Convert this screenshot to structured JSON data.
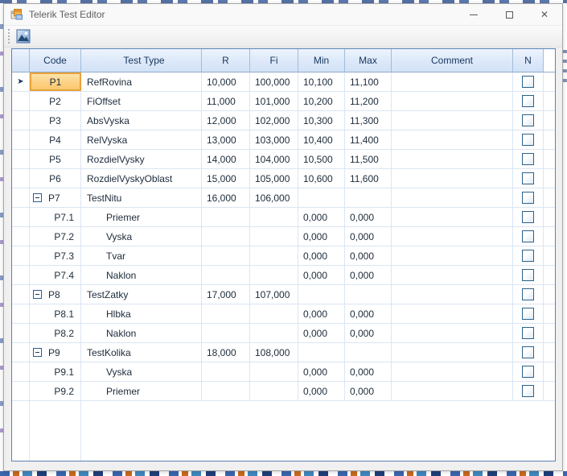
{
  "window": {
    "title": "Telerik Test Editor",
    "app_icon": "winforms-form-icon",
    "controls": [
      {
        "name": "minimize",
        "glyph": "—"
      },
      {
        "name": "maximize",
        "glyph": "□"
      },
      {
        "name": "close",
        "glyph": "✕"
      }
    ]
  },
  "toolbar": {
    "buttons": [
      {
        "name": "image-button",
        "icon": "image-icon"
      }
    ]
  },
  "grid": {
    "columns": [
      {
        "key": "rowheader",
        "label": ""
      },
      {
        "key": "code",
        "label": "Code"
      },
      {
        "key": "type",
        "label": "Test Type"
      },
      {
        "key": "r",
        "label": "R"
      },
      {
        "key": "fi",
        "label": "Fi"
      },
      {
        "key": "min",
        "label": "Min"
      },
      {
        "key": "max",
        "label": "Max"
      },
      {
        "key": "comment",
        "label": "Comment"
      },
      {
        "key": "n",
        "label": "N"
      }
    ],
    "rows": [
      {
        "code": "P1",
        "type": "RefRovina",
        "r": "10,000",
        "fi": "100,000",
        "min": "10,100",
        "max": "11,100",
        "comment": "",
        "level": 0,
        "expandable": false,
        "expanded": null,
        "selected": true,
        "checked": false
      },
      {
        "code": "P2",
        "type": "FiOffset",
        "r": "11,000",
        "fi": "101,000",
        "min": "10,200",
        "max": "11,200",
        "comment": "",
        "level": 0,
        "expandable": false,
        "expanded": null,
        "selected": false,
        "checked": false
      },
      {
        "code": "P3",
        "type": "AbsVyska",
        "r": "12,000",
        "fi": "102,000",
        "min": "10,300",
        "max": "11,300",
        "comment": "",
        "level": 0,
        "expandable": false,
        "expanded": null,
        "selected": false,
        "checked": false
      },
      {
        "code": "P4",
        "type": "RelVyska",
        "r": "13,000",
        "fi": "103,000",
        "min": "10,400",
        "max": "11,400",
        "comment": "",
        "level": 0,
        "expandable": false,
        "expanded": null,
        "selected": false,
        "checked": false
      },
      {
        "code": "P5",
        "type": "RozdielVysky",
        "r": "14,000",
        "fi": "104,000",
        "min": "10,500",
        "max": "11,500",
        "comment": "",
        "level": 0,
        "expandable": false,
        "expanded": null,
        "selected": false,
        "checked": false
      },
      {
        "code": "P6",
        "type": "RozdielVyskyOblast",
        "r": "15,000",
        "fi": "105,000",
        "min": "10,600",
        "max": "11,600",
        "comment": "",
        "level": 0,
        "expandable": false,
        "expanded": null,
        "selected": false,
        "checked": false
      },
      {
        "code": "P7",
        "type": "TestNitu",
        "r": "16,000",
        "fi": "106,000",
        "min": "",
        "max": "",
        "comment": "",
        "level": 0,
        "expandable": true,
        "expanded": true,
        "selected": false,
        "checked": false
      },
      {
        "code": "P7.1",
        "type": "Priemer",
        "r": "",
        "fi": "",
        "min": "0,000",
        "max": "0,000",
        "comment": "",
        "level": 1,
        "expandable": false,
        "expanded": null,
        "selected": false,
        "checked": false
      },
      {
        "code": "P7.2",
        "type": "Vyska",
        "r": "",
        "fi": "",
        "min": "0,000",
        "max": "0,000",
        "comment": "",
        "level": 1,
        "expandable": false,
        "expanded": null,
        "selected": false,
        "checked": false
      },
      {
        "code": "P7.3",
        "type": "Tvar",
        "r": "",
        "fi": "",
        "min": "0,000",
        "max": "0,000",
        "comment": "",
        "level": 1,
        "expandable": false,
        "expanded": null,
        "selected": false,
        "checked": false
      },
      {
        "code": "P7.4",
        "type": "Naklon",
        "r": "",
        "fi": "",
        "min": "0,000",
        "max": "0,000",
        "comment": "",
        "level": 1,
        "expandable": false,
        "expanded": null,
        "selected": false,
        "checked": false
      },
      {
        "code": "P8",
        "type": "TestZatky",
        "r": "17,000",
        "fi": "107,000",
        "min": "",
        "max": "",
        "comment": "",
        "level": 0,
        "expandable": true,
        "expanded": true,
        "selected": false,
        "checked": false
      },
      {
        "code": "P8.1",
        "type": "Hlbka",
        "r": "",
        "fi": "",
        "min": "0,000",
        "max": "0,000",
        "comment": "",
        "level": 1,
        "expandable": false,
        "expanded": null,
        "selected": false,
        "checked": false
      },
      {
        "code": "P8.2",
        "type": "Naklon",
        "r": "",
        "fi": "",
        "min": "0,000",
        "max": "0,000",
        "comment": "",
        "level": 1,
        "expandable": false,
        "expanded": null,
        "selected": false,
        "checked": false
      },
      {
        "code": "P9",
        "type": "TestKolika",
        "r": "18,000",
        "fi": "108,000",
        "min": "",
        "max": "",
        "comment": "",
        "level": 0,
        "expandable": true,
        "expanded": true,
        "selected": false,
        "checked": false
      },
      {
        "code": "P9.1",
        "type": "Vyska",
        "r": "",
        "fi": "",
        "min": "0,000",
        "max": "0,000",
        "comment": "",
        "level": 1,
        "expandable": false,
        "expanded": null,
        "selected": false,
        "checked": false
      },
      {
        "code": "P9.2",
        "type": "Priemer",
        "r": "",
        "fi": "",
        "min": "0,000",
        "max": "0,000",
        "comment": "",
        "level": 1,
        "expandable": false,
        "expanded": null,
        "selected": false,
        "checked": false
      }
    ]
  },
  "colors": {
    "header_bg_top": "#eef4fd",
    "header_bg_bottom": "#d2e2f6",
    "header_text": "#17365d",
    "grid_border": "#5b82b5",
    "grid_line": "#dae5f4",
    "selected_cell_bg": "#fcd086",
    "selected_cell_border": "#e8a23a",
    "checkbox_border": "#2c628b",
    "window_bg": "#f0f0f0",
    "titlebar_bg": "#f9f9f9"
  }
}
